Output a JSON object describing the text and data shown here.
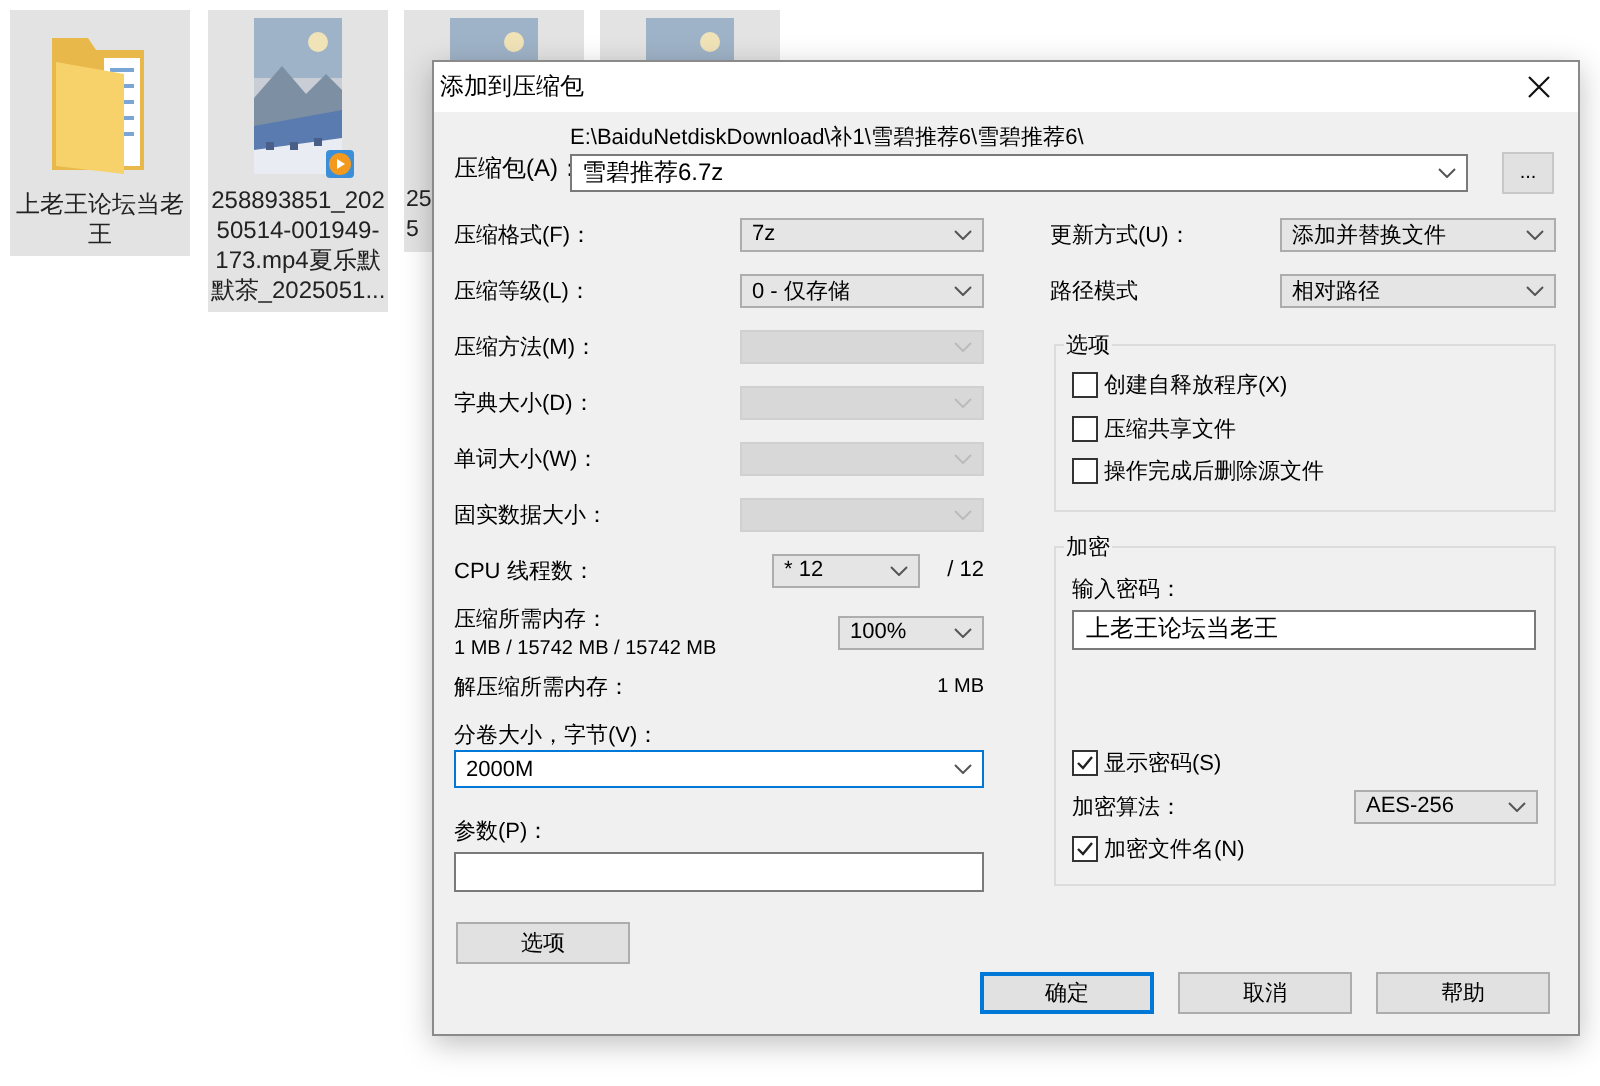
{
  "desktop": {
    "items": [
      {
        "kind": "folder",
        "label_lines": [
          "上老王论坛当老",
          "王"
        ]
      },
      {
        "kind": "video",
        "label_lines": [
          "258893851_202",
          "50514-001949-",
          "173.mp4夏乐默",
          "默茶_2025051..."
        ]
      },
      {
        "kind": "picture",
        "label_lines": [
          "25",
          "5"
        ]
      },
      {
        "kind": "picture"
      }
    ]
  },
  "dialog": {
    "title": "添加到压缩包",
    "archive": {
      "label": "压缩包(A)：",
      "path": "E:\\BaiduNetdiskDownload\\补1\\雪碧推荐6\\雪碧推荐6\\",
      "value": "雪碧推荐6.7z",
      "browse_button": "..."
    },
    "left_fields": [
      {
        "kind": "combo",
        "label": "压缩格式(F)：",
        "value": "7z",
        "disabled": false
      },
      {
        "kind": "combo",
        "label": "压缩等级(L)：",
        "value": "0 - 仅存储",
        "disabled": false
      },
      {
        "kind": "combo",
        "label": "压缩方法(M)：",
        "disabled": true
      },
      {
        "kind": "combo",
        "label": "字典大小(D)：",
        "disabled": true
      },
      {
        "kind": "combo",
        "label": "单词大小(W)：",
        "disabled": true
      },
      {
        "kind": "combo",
        "label": "固实数据大小：",
        "disabled": true
      },
      {
        "kind": "threads",
        "label": "CPU 线程数：",
        "value": "* 12",
        "disabled": false,
        "suffix": "/ 12"
      },
      {
        "kind": "memory",
        "label": "压缩所需内存：",
        "detail": "1 MB / 15742 MB / 15742 MB",
        "value": "100%",
        "disabled": false
      },
      {
        "kind": "info",
        "label": "解压缩所需内存：",
        "value": "1 MB"
      }
    ],
    "volume": {
      "label": "分卷大小，字节(V)：",
      "value": "2000M",
      "focused": true
    },
    "params": {
      "label": "参数(P)："
    },
    "options_button": "选项",
    "right_fields": [
      {
        "label": "更新方式(U)：",
        "value": "添加并替换文件"
      },
      {
        "label": "路径模式",
        "value": "相对路径"
      }
    ],
    "options_group": {
      "title": "选项",
      "checkboxes": [
        {
          "label": "创建自释放程序(X)",
          "checked": false
        },
        {
          "label": "压缩共享文件",
          "checked": false
        },
        {
          "label": "操作完成后删除源文件",
          "checked": false
        }
      ]
    },
    "encryption": {
      "title": "加密",
      "password_label": "输入密码：",
      "password_value": "上老王论坛当老王",
      "show_password": {
        "label": "显示密码(S)",
        "checked": true
      },
      "method": {
        "label": "加密算法：",
        "value": "AES-256"
      },
      "encrypt_names": {
        "label": "加密文件名(N)",
        "checked": true
      }
    },
    "buttons": [
      {
        "label": "确定",
        "default": true
      },
      {
        "label": "取消",
        "default": false
      },
      {
        "label": "帮助",
        "default": false
      }
    ]
  }
}
